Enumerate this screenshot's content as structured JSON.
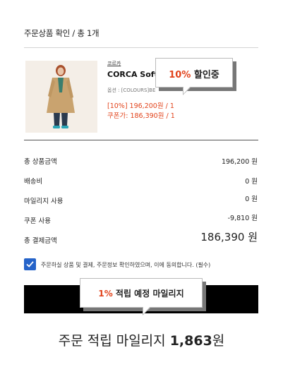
{
  "header": {
    "title": "주문상품 확인 / 총 1개"
  },
  "product": {
    "brand": "코르카",
    "name": "CORCA Soft",
    "option": "옵션 : [COLOURS]BE",
    "discount_price": "[10%] 196,200원 / 1",
    "coupon_price": "쿠폰가: 186,390원 / 1",
    "image_icon": "model-wearing-camel-coat-photo"
  },
  "tooltip_discount": {
    "highlight": "10%",
    "text": " 할인중"
  },
  "summary": {
    "rows": [
      {
        "label": "총 상품금액",
        "value": "196,200 원"
      },
      {
        "label": "배송비",
        "value": "0 원"
      },
      {
        "label": "마일리지 사용",
        "value": "0 원"
      },
      {
        "label": "쿠폰 사용",
        "value": "-9,810 원"
      }
    ],
    "total_label": "총 결제금액",
    "total_value": "186,390 원"
  },
  "agreement": {
    "checked": true,
    "text": "주문하실 상품 및 결제, 주문정보 확인하였으며, 이에 동의합니다. (필수)"
  },
  "tooltip_mileage": {
    "highlight": "1%",
    "text": " 적립 예정 마일리지"
  },
  "mileage": {
    "prefix": "주문 적립 마일리지 ",
    "amount": "1,863",
    "unit": "원"
  },
  "colors": {
    "accent": "#e2431b",
    "checkbox": "#2563c9",
    "button": "#000000"
  }
}
